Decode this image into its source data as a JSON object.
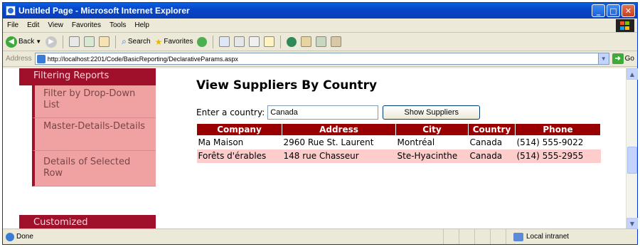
{
  "window": {
    "title": "Untitled Page - Microsoft Internet Explorer"
  },
  "menu": [
    "File",
    "Edit",
    "View",
    "Favorites",
    "Tools",
    "Help"
  ],
  "toolbar": {
    "back": "Back",
    "search": "Search",
    "favorites": "Favorites"
  },
  "address": {
    "label": "Address",
    "url": "http://localhost:2201/Code/BasicReporting/DeclarativeParams.aspx",
    "go": "Go"
  },
  "nav": {
    "section_top": "Filtering Reports",
    "items": [
      "Filter by Drop-Down List",
      "Master-Details-Details",
      "Details of Selected Row"
    ],
    "section_bottom": "Customized"
  },
  "main": {
    "heading": "View Suppliers By Country",
    "country_label": "Enter a country:",
    "country_value": "Canada",
    "button_label": "Show Suppliers"
  },
  "grid": {
    "headers": [
      "Company",
      "Address",
      "City",
      "Country",
      "Phone"
    ],
    "rows": [
      [
        "Ma Maison",
        "2960 Rue St. Laurent",
        "Montréal",
        "Canada",
        "(514) 555-9022"
      ],
      [
        "Forêts d'érables",
        "148 rue Chasseur",
        "Ste-Hyacinthe",
        "Canada",
        "(514) 555-2955"
      ]
    ]
  },
  "status": {
    "text": "Done",
    "zone": "Local intranet"
  },
  "colors": {
    "nav_dark": "#a0102a",
    "nav_light": "#f0a2a2",
    "grid_header": "#990000",
    "grid_alt": "#ffcccc"
  }
}
